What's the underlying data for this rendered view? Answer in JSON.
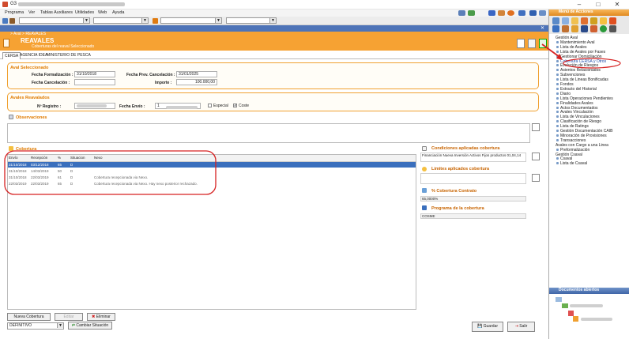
{
  "window": {
    "title": "G3 -",
    "min": "–",
    "max": "□",
    "close": "✕"
  },
  "menubar": [
    "Programa",
    "Ver",
    "Tablas Auxiliares",
    "Utilidades",
    "Web",
    "Ayuda"
  ],
  "breadcrumb": "> Aval  > REAVALES",
  "header": {
    "title": "REAVALES",
    "subtitle": "Coberturas del reaval Seleccionado"
  },
  "tabs": [
    "CERSA",
    "AGENCIA IDEA",
    "MINISTERIO DE PESCA"
  ],
  "aval": {
    "title": "Aval Seleccionado",
    "fecha_formalizacion_label": "Fecha Formalización :",
    "fecha_formalizacion": "31/10/2018",
    "fecha_cancelacion_label": "Fecha Cancelación :",
    "fecha_cancelacion": "",
    "fecha_prev_cancelacion_label": "Fecha Prev. Cancelación :",
    "fecha_prev_cancelacion": "31/01/2025",
    "importe_label": "Importe :",
    "importe": "100.000,00"
  },
  "reavales": {
    "title": "Avales Reavalados",
    "registro_label": "Nº Registro :",
    "envio_label": "Fecha Envío :",
    "envio_prefix": "1",
    "especial_label": "Especial",
    "coste_label": "Coste"
  },
  "observaciones_label": "Observaciones",
  "cobertura": {
    "label": "Cobertura",
    "columns": [
      "Envío",
      "Recepción",
      "%",
      "Situacion",
      "Nexo"
    ],
    "rows": [
      [
        "31/10/2018",
        "03/12/2018",
        "65",
        "D",
        ""
      ],
      [
        "31/10/2018",
        "14/03/2019",
        "50",
        "D",
        ""
      ],
      [
        "31/10/2018",
        "22/03/2019",
        "61",
        "D",
        "Cobertura recepcionada via Nexo."
      ],
      [
        "22/03/2019",
        "22/03/2019",
        "65",
        "D",
        "Cobertura recepcionada via Nexo. Hay nexo posterior rechazado."
      ]
    ]
  },
  "condiciones": {
    "label": "Condiciones aplicadas cobertura",
    "value": "Financiación Nueva Inversión Activos Fijos productos 01,04,14"
  },
  "limites": {
    "label": "Limites aplicados cobertura"
  },
  "contrato": {
    "label": "% Cobertura Contrato",
    "value": "65,0000%"
  },
  "programa": {
    "label": "Programa de la cobertura",
    "value": "COSME"
  },
  "buttons": {
    "nueva": "Nueva Cobertura",
    "editar": "Editar",
    "eliminar": "Eliminar",
    "situacion_value": "DEFINITIVO",
    "cambiar": "Cambiar Situación",
    "guardar": "Guardar",
    "salir": "Salir"
  },
  "right_panel": {
    "menu_title": "Menú de Acciones",
    "tree": [
      {
        "t": "Gestión Aval",
        "lvl": 0
      },
      {
        "t": "Mantenimiento Aval",
        "lvl": 1
      },
      {
        "t": "Lista de Avales",
        "lvl": 1
      },
      {
        "t": "Lista de Avales por Fases",
        "lvl": 1
      },
      {
        "t": "Gestionar Domiciliación",
        "lvl": 1
      },
      {
        "t": "Cobertura CERSA y Otros",
        "lvl": 1
      },
      {
        "t": "Evolución de Riesgos",
        "lvl": 1
      },
      {
        "t": "Asientos Relacionados",
        "lvl": 1
      },
      {
        "t": "Subvenciones",
        "lvl": 1
      },
      {
        "t": "Lista de Lineas Bonificadas",
        "lvl": 1
      },
      {
        "t": "Fondos",
        "lvl": 1
      },
      {
        "t": "Extracto del Historial",
        "lvl": 1
      },
      {
        "t": "Diario",
        "lvl": 1
      },
      {
        "t": "Lista Operaciones Pendientes",
        "lvl": 1
      },
      {
        "t": "Finalidades Avales",
        "lvl": 1
      },
      {
        "t": "Actos Documentados",
        "lvl": 1
      },
      {
        "t": "Avales Vinculación",
        "lvl": 1
      },
      {
        "t": "Lista de Vinculaciones",
        "lvl": 1
      },
      {
        "t": "Clasificación de Riesgo",
        "lvl": 1
      },
      {
        "t": "Lista de Ratings",
        "lvl": 1
      },
      {
        "t": "Gestión Documentación CAIB",
        "lvl": 1
      },
      {
        "t": "Minoración de Provisiones",
        "lvl": 1
      },
      {
        "t": "Transacciones",
        "lvl": 1
      },
      {
        "t": "Avales con Cargo a una Linea",
        "lvl": 0
      },
      {
        "t": "Preformalización",
        "lvl": 1
      },
      {
        "t": "Gestión Csaval",
        "lvl": 0
      },
      {
        "t": "Csaval",
        "lvl": 1
      },
      {
        "t": "Lista de Csaval",
        "lvl": 1
      }
    ],
    "docs_title": "Documentos abiertos"
  }
}
